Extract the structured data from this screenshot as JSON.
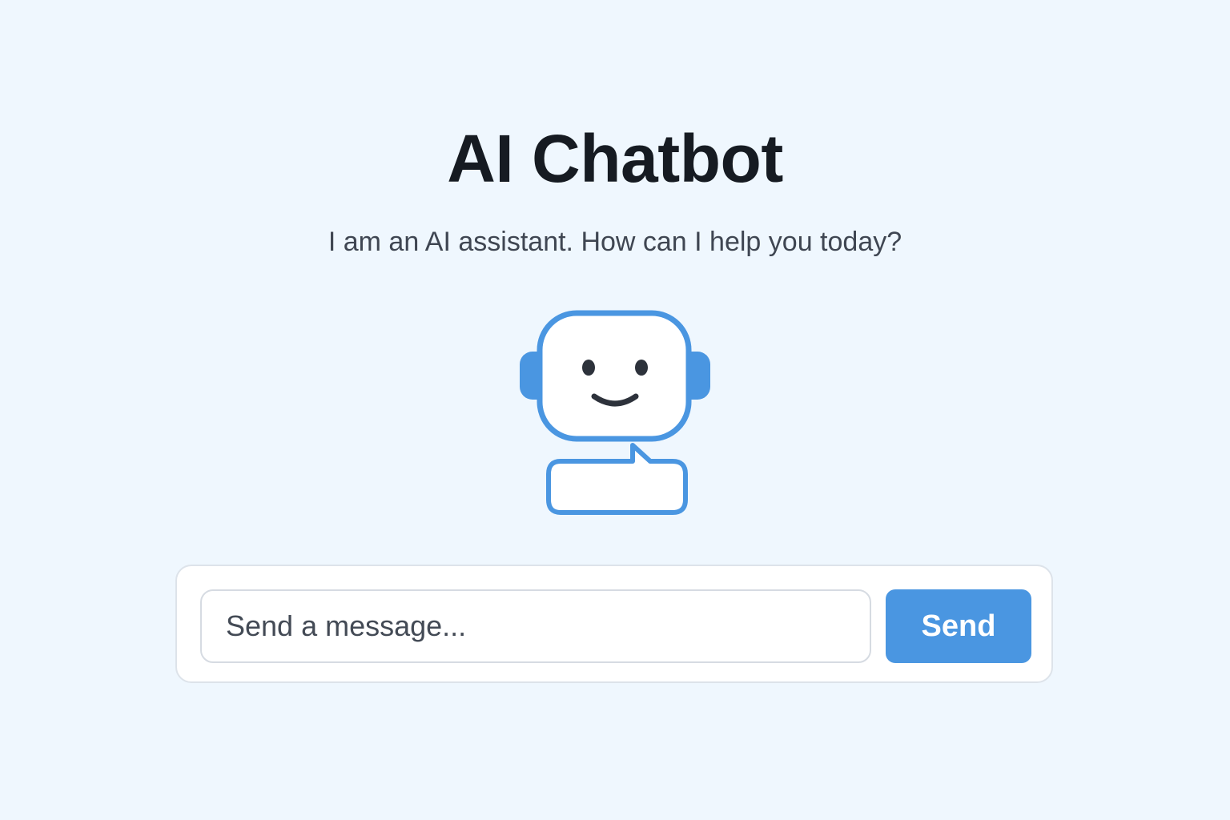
{
  "header": {
    "title": "AI Chatbot",
    "subtitle": "I am an AI assistant. How can I help you today?"
  },
  "illustration": {
    "icon": "robot-chat-icon",
    "accent_color": "#4a96e1"
  },
  "composer": {
    "input_placeholder": "Send a message...",
    "input_value": "",
    "send_label": "Send"
  },
  "colors": {
    "background": "#eff7fe",
    "primary": "#4a96e1",
    "title": "#161b22",
    "subtitle": "#3f4652"
  }
}
